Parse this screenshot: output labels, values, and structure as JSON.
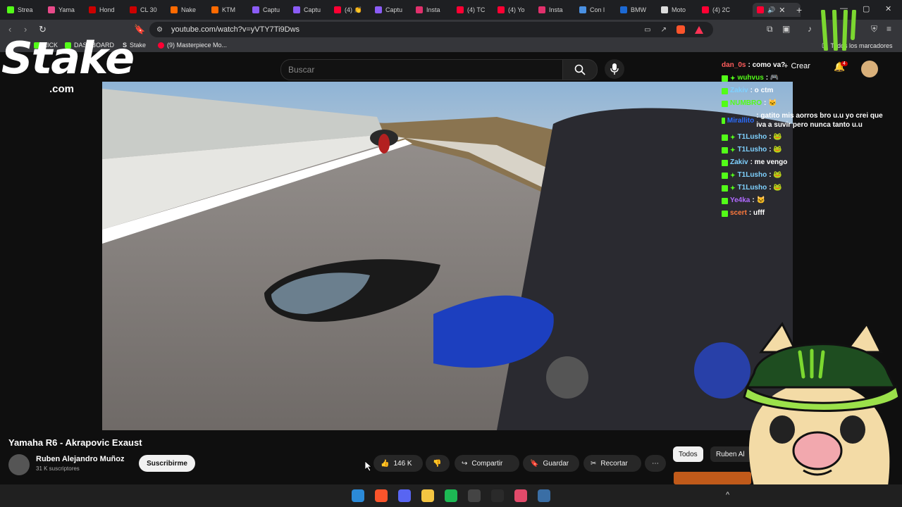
{
  "tabs": [
    {
      "label": "Strea",
      "color": "#53fc18"
    },
    {
      "label": "Yama",
      "color": "#e84a8a"
    },
    {
      "label": "Hond",
      "color": "#cc0000"
    },
    {
      "label": "CL 30",
      "color": "#cc0000"
    },
    {
      "label": "Nake",
      "color": "#ff6a00"
    },
    {
      "label": "KTM",
      "color": "#ff6a00"
    },
    {
      "label": "Captu",
      "color": "#8b5cf6"
    },
    {
      "label": "Captu",
      "color": "#8b5cf6"
    },
    {
      "label": "(4) 👏",
      "color": "#ff0033"
    },
    {
      "label": "Captu",
      "color": "#8b5cf6"
    },
    {
      "label": "Insta",
      "color": "#e1306c"
    },
    {
      "label": "(4) TC",
      "color": "#ff0033"
    },
    {
      "label": "(4) Yo",
      "color": "#ff0033"
    },
    {
      "label": "Insta",
      "color": "#e1306c"
    },
    {
      "label": "Con l",
      "color": "#4a90e2"
    },
    {
      "label": "BMW",
      "color": "#1c69d4"
    },
    {
      "label": "Moto",
      "color": "#dddddd"
    },
    {
      "label": "(4) 2C",
      "color": "#ff0033"
    }
  ],
  "address": {
    "url": "youtube.com/watch?v=yVTY7Ti9Dws"
  },
  "bookmarks": [
    {
      "label": "KICK",
      "color": "#53fc18"
    },
    {
      "label": "DASHBOARD",
      "color": "#53fc18"
    },
    {
      "label": "Stake",
      "color": "#ffffff"
    },
    {
      "label": "(9) Masterpiece Mo...",
      "color": "#ff0033"
    }
  ],
  "bookmarks_all": "Todos los marcadores",
  "youtube": {
    "search_placeholder": "Buscar",
    "create_label": "Crear",
    "notifications_count": "4",
    "video_title": "Yamaha R6 - Akrapovic Exaust",
    "channel_name": "Ruben Alejandro Muñoz",
    "channel_subs": "31 K suscriptores",
    "subscribe_label": "Suscribirme",
    "likes": "146 K",
    "share_label": "Compartir",
    "save_label": "Guardar",
    "clip_label": "Recortar",
    "chips": [
      "Todos",
      "Ruben Al"
    ]
  },
  "overlay": {
    "stake_text": "Stake",
    "stake_domain": ".com"
  },
  "chat": [
    {
      "user": "dan_0s",
      "text": ": como va?",
      "color": "#ff5c5c",
      "badges": 0
    },
    {
      "user": "wuhvus",
      "text": ": 🎮",
      "color": "#53fc18",
      "badges": 2
    },
    {
      "user": "Zakiv",
      "text": ": o ctm",
      "color": "#7fd1ff",
      "badges": 1
    },
    {
      "user": "NUMBRO",
      "text": ": 🐱",
      "color": "#53fc18",
      "badges": 1
    },
    {
      "user": "Mirallito",
      "text": ": gatito mis aorros bro u.u yo crei que iva a suvir pero nunca tanto u.u",
      "color": "#2b6cff",
      "badges": 1
    },
    {
      "user": "T1Lusho",
      "text": ": 🐸",
      "color": "#7fd1ff",
      "badges": 2
    },
    {
      "user": "T1Lusho",
      "text": ": 🐸",
      "color": "#7fd1ff",
      "badges": 2
    },
    {
      "user": "Zakiv",
      "text": ": me vengo",
      "color": "#7fd1ff",
      "badges": 1
    },
    {
      "user": "T1Lusho",
      "text": ": 🐸",
      "color": "#7fd1ff",
      "badges": 2
    },
    {
      "user": "T1Lusho",
      "text": ": 🐸",
      "color": "#7fd1ff",
      "badges": 2
    },
    {
      "user": "Ye4ka",
      "text": ": 🐱",
      "color": "#b06aff",
      "badges": 1
    },
    {
      "user": "scert",
      "text": ": ufff",
      "color": "#ff7a3d",
      "badges": 1
    }
  ],
  "taskbar": [
    {
      "name": "start",
      "color": "#2b8ad8"
    },
    {
      "name": "brave",
      "color": "#fb542b"
    },
    {
      "name": "discord",
      "color": "#5865f2"
    },
    {
      "name": "files",
      "color": "#f4c542"
    },
    {
      "name": "spotify",
      "color": "#1db954"
    },
    {
      "name": "obs",
      "color": "#444444"
    },
    {
      "name": "app",
      "color": "#2a2a2a"
    },
    {
      "name": "vpn",
      "color": "#e24a6a"
    },
    {
      "name": "calculator",
      "color": "#3a6ea5"
    }
  ]
}
